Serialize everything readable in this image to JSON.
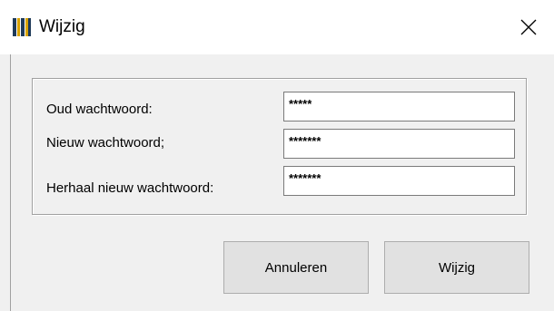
{
  "window": {
    "title": "Wijzig",
    "close_glyph": "✕",
    "icon": "app-bars-icon"
  },
  "form": {
    "old_password": {
      "label": "Oud wachtwoord:",
      "value": "*****"
    },
    "new_password": {
      "label": "Nieuw wachtwoord;",
      "value": "*******"
    },
    "repeat_password": {
      "label": "Herhaal nieuw wachtwoord:",
      "value": "*******"
    }
  },
  "buttons": {
    "cancel_label": "Annuleren",
    "submit_label": "Wijzig"
  },
  "colors": {
    "icon_dark": "#1f3b5a",
    "icon_gold": "#d8a200"
  }
}
